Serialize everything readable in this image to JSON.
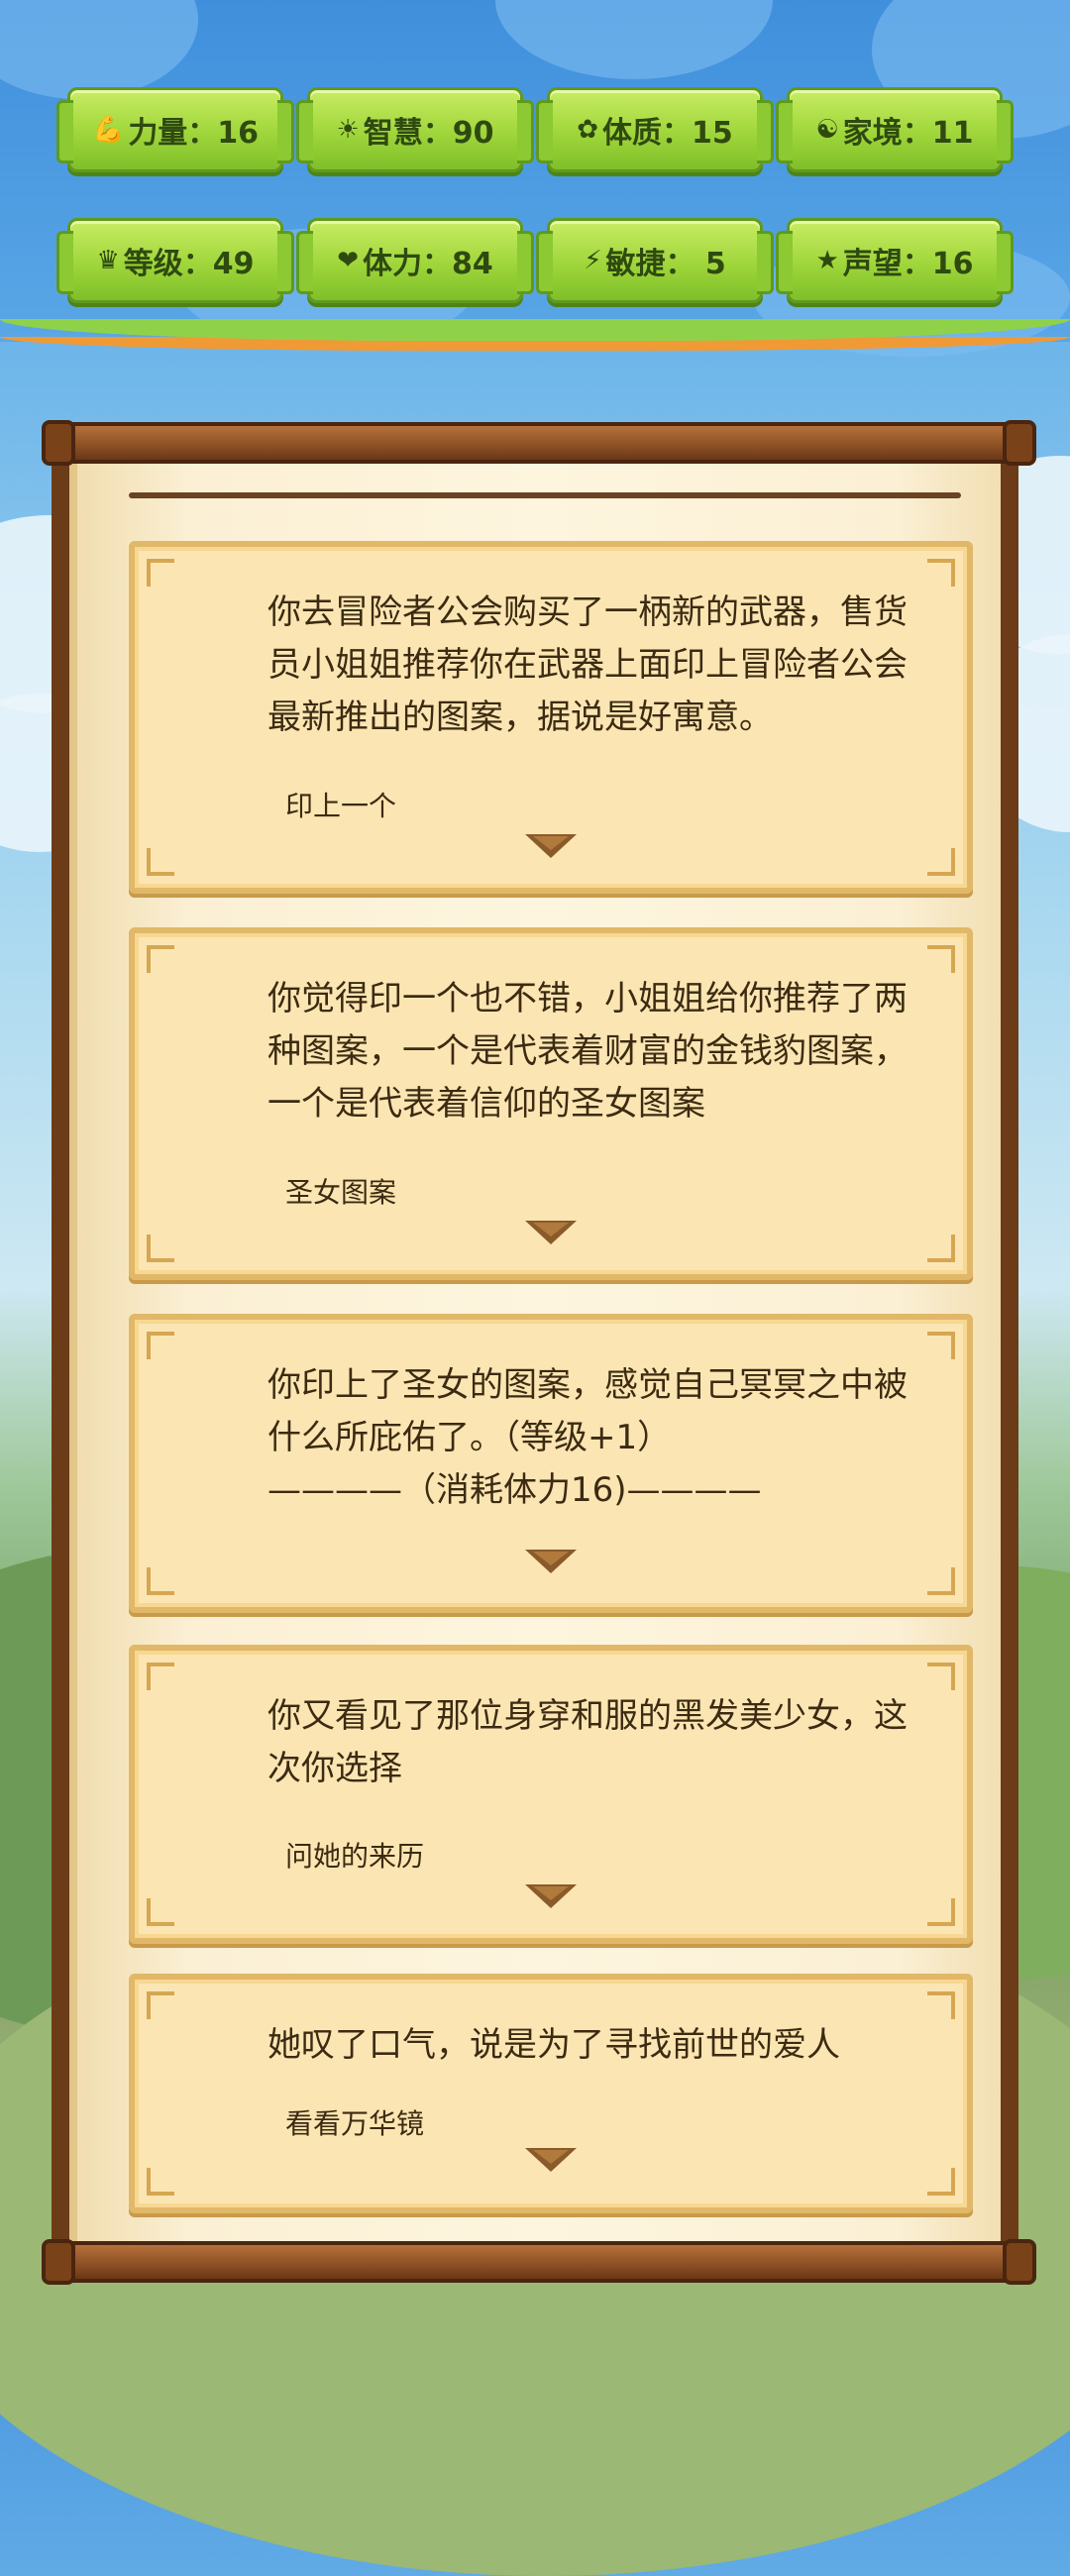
{
  "stats": [
    {
      "icon": "muscle-icon",
      "glyph": "💪",
      "label": "力量：16"
    },
    {
      "icon": "bulb-icon",
      "glyph": "☀",
      "label": "智慧：90"
    },
    {
      "icon": "physique-icon",
      "glyph": "✿",
      "label": "体质：15"
    },
    {
      "icon": "family-icon",
      "glyph": "☯",
      "label": "家境：11"
    },
    {
      "icon": "crown-icon",
      "glyph": "♛",
      "label": "等级：49"
    },
    {
      "icon": "heart-icon",
      "glyph": "❤",
      "label": "体力：84"
    },
    {
      "icon": "lightning-icon",
      "glyph": "⚡",
      "label": "敏捷： 5"
    },
    {
      "icon": "star-icon",
      "glyph": "★",
      "label": "声望：16"
    }
  ],
  "story": [
    {
      "text": "你去冒险者公会购买了一柄新的武器，售货员小姐姐推荐你在武器上面印上冒险者公会最新推出的图案，据说是好寓意。",
      "choice": "印上一个"
    },
    {
      "text": "你觉得印一个也不错，小姐姐给你推荐了两种图案，一个是代表着财富的金钱豹图案，一个是代表着信仰的圣女图案",
      "choice": "圣女图案"
    },
    {
      "text": "你印上了圣女的图案，感觉自己冥冥之中被什么所庇佑了。（等级+1）\n————（消耗体力16)————",
      "choice": ""
    },
    {
      "text": "你又看见了那位身穿和服的黑发美少女，这次你选择",
      "choice": "问她的来历"
    },
    {
      "text": "她叹了口气，说是为了寻找前世的爱人",
      "choice": "看看万华镜"
    }
  ]
}
